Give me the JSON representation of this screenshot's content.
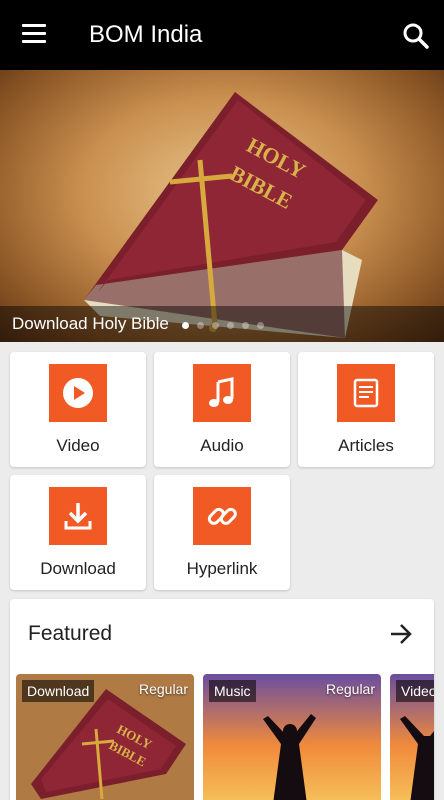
{
  "appbar": {
    "title": "BOM India",
    "menu_icon": "hamburger-menu-icon",
    "search_icon": "search-icon"
  },
  "banner": {
    "caption": "Download Holy Bible",
    "image_subject": "holy-bible-with-crucifix",
    "slides_count": 6,
    "active_slide": 1
  },
  "categories": [
    {
      "label": "Video",
      "icon": "play-icon"
    },
    {
      "label": "Audio",
      "icon": "music-note-icon"
    },
    {
      "label": "Articles",
      "icon": "article-icon"
    },
    {
      "label": "Download",
      "icon": "download-icon"
    },
    {
      "label": "Hyperlink",
      "icon": "link-icon"
    }
  ],
  "featured": {
    "title": "Featured",
    "more_icon": "arrow-right-icon",
    "items": [
      {
        "tag": "Download",
        "type": "Regular",
        "image_subject": "holy-bible-with-crucifix"
      },
      {
        "tag": "Music",
        "type": "Regular",
        "image_subject": "figure-with-raised-arms-at-sunset"
      },
      {
        "tag": "Video",
        "type": "",
        "image_subject": "figure-with-raised-arms-at-sunset"
      }
    ]
  },
  "colors": {
    "appbar": "#000000",
    "accent": "#f15a24",
    "background": "#ececec",
    "card": "#ffffff"
  }
}
